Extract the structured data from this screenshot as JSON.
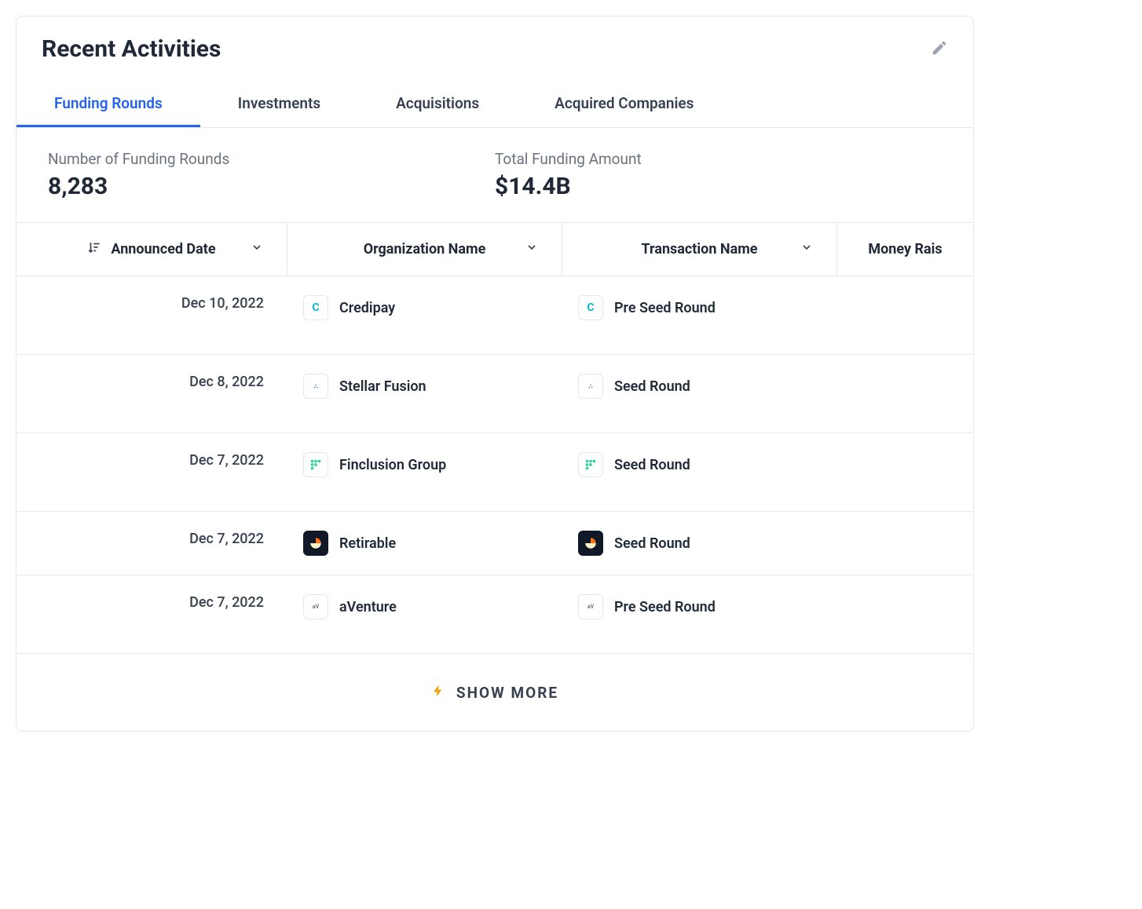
{
  "header": {
    "title": "Recent Activities"
  },
  "tabs": [
    {
      "label": "Funding Rounds",
      "active": true
    },
    {
      "label": "Investments",
      "active": false
    },
    {
      "label": "Acquisitions",
      "active": false
    },
    {
      "label": "Acquired Companies",
      "active": false
    }
  ],
  "stats": {
    "rounds_label": "Number of Funding Rounds",
    "rounds_value": "8,283",
    "funding_label": "Total Funding Amount",
    "funding_value": "$14.4B"
  },
  "columns": {
    "date": "Announced Date",
    "org": "Organization Name",
    "txn": "Transaction Name",
    "money": "Money Rais"
  },
  "rows": [
    {
      "date": "Dec 10, 2022",
      "org": "Credipay",
      "org_icon": "credipay",
      "txn": "Pre Seed Round"
    },
    {
      "date": "Dec 8, 2022",
      "org": "Stellar Fusion",
      "org_icon": "stellar",
      "txn": "Seed Round"
    },
    {
      "date": "Dec 7, 2022",
      "org": "Finclusion Group",
      "org_icon": "finclusion",
      "txn": "Seed Round"
    },
    {
      "date": "Dec 7, 2022",
      "org": "Retirable",
      "org_icon": "retirable",
      "txn": "Seed Round"
    },
    {
      "date": "Dec 7, 2022",
      "org": "aVenture",
      "org_icon": "aventure",
      "txn": "Pre Seed Round"
    }
  ],
  "show_more": "SHOW MORE"
}
